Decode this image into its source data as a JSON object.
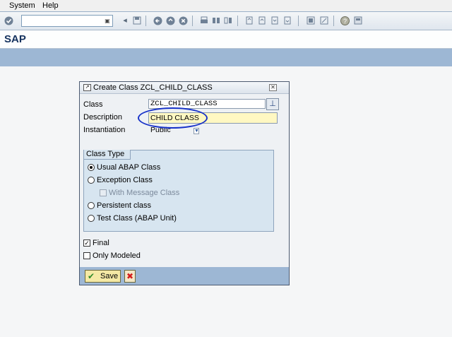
{
  "menu": {
    "items": [
      {
        "label": "System"
      },
      {
        "label": "Help"
      }
    ]
  },
  "toolbar": {
    "command_field_value": "",
    "icons": [
      "enter-icon",
      "back-arrow-icon",
      "save-icon",
      "back-icon",
      "exit-icon",
      "cancel-icon",
      "print-icon",
      "find-icon",
      "find-next-icon",
      "first-page-icon",
      "previous-page-icon",
      "next-page-icon",
      "last-page-icon",
      "new-session-icon",
      "create-shortcut-icon",
      "help-icon",
      "layout-icon"
    ]
  },
  "title": {
    "text": "SAP"
  },
  "dialog": {
    "title": "Create Class ZCL_CHILD_CLASS",
    "fields": {
      "class_label": "Class",
      "class_value": "ZCL_CHILD_CLASS",
      "description_label": "Description",
      "description_value": "CHILD CLASS",
      "instantiation_label": "Instantiation",
      "instantiation_value": "Public"
    },
    "class_type": {
      "title": "Class Type",
      "options": [
        {
          "label": "Usual ABAP Class",
          "selected": true
        },
        {
          "label": "Exception Class",
          "selected": false
        },
        {
          "label": "With Message Class",
          "checked": false,
          "disabled": true
        },
        {
          "label": "Persistent class",
          "selected": false
        },
        {
          "label": "Test Class (ABAP Unit)",
          "selected": false
        }
      ]
    },
    "final_label": "Final",
    "final_checked": true,
    "only_modeled_label": "Only Modeled",
    "only_modeled_checked": false,
    "save_label": "Save"
  },
  "colors": {
    "accent_bar": "#9db7d4",
    "required_field": "#fff8c2",
    "annotation_oval": "#1832c8"
  }
}
